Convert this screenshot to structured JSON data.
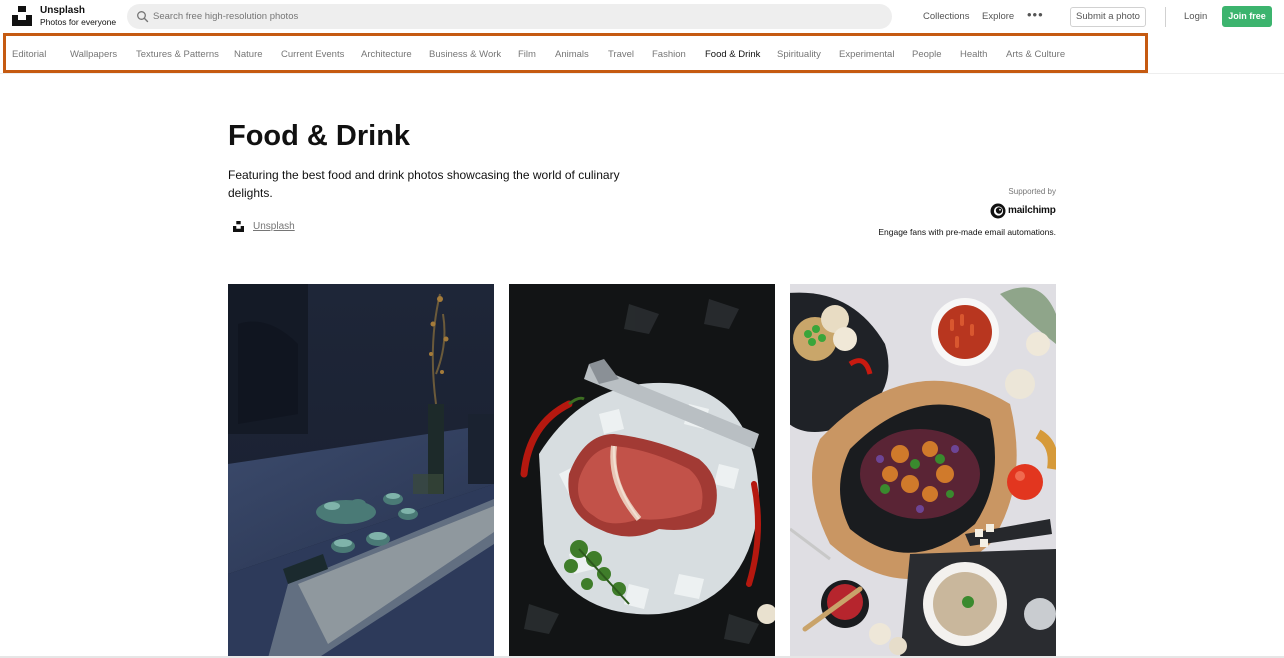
{
  "header": {
    "brand_name": "Unsplash",
    "brand_tagline": "Photos for everyone",
    "search_placeholder": "Search free high-resolution photos",
    "nav": [
      "Collections",
      "Explore"
    ],
    "more_label": "•••",
    "submit_label": "Submit a photo",
    "login_label": "Login",
    "join_label": "Join free"
  },
  "topics": {
    "items": [
      "Editorial",
      "Wallpapers",
      "Textures & Patterns",
      "Nature",
      "Current Events",
      "Architecture",
      "Business & Work",
      "Film",
      "Animals",
      "Travel",
      "Fashion",
      "Food & Drink",
      "Spirituality",
      "Experimental",
      "People",
      "Health",
      "Arts & Culture"
    ],
    "active": "Food & Drink"
  },
  "page": {
    "title": "Food & Drink",
    "description": "Featuring the best food and drink photos showcasing the world of culinary delights.",
    "author": "Unsplash"
  },
  "sponsor": {
    "supported_by": "Supported by",
    "name": "mailchimp",
    "tagline": "Engage fans with pre-made email automations."
  },
  "colors": {
    "accent_green": "#3cb46e",
    "highlight_border": "#c55a11"
  }
}
